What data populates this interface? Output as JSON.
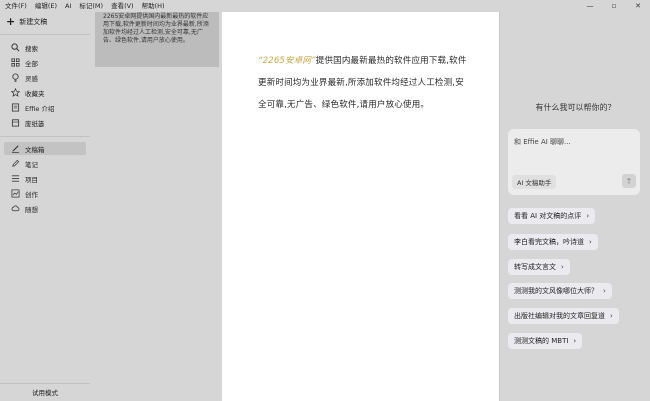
{
  "menubar": {
    "items": [
      "文件(F)",
      "编辑(E)",
      "AI",
      "标记(M)",
      "查看(V)",
      "帮助(H)"
    ],
    "controls": [
      "—",
      "▫",
      "✕"
    ]
  },
  "sidebar": {
    "new_doc": "新建文稿",
    "items": [
      {
        "label": "搜索",
        "icon": "search-icon"
      },
      {
        "label": "全部",
        "icon": "grid-icon"
      },
      {
        "label": "灵感",
        "icon": "lightbulb-icon"
      },
      {
        "label": "收藏夹",
        "icon": "star-icon"
      },
      {
        "label": "Effie 介绍",
        "icon": "document-icon"
      },
      {
        "label": "废纸篓",
        "icon": "trash-icon"
      }
    ],
    "categories": [
      {
        "label": "文稿箱",
        "icon": "pen-icon",
        "active": true
      },
      {
        "label": "笔记",
        "icon": "pencil-icon"
      },
      {
        "label": "项目",
        "icon": "list-icon"
      },
      {
        "label": "创作",
        "icon": "chart-icon"
      },
      {
        "label": "随想",
        "icon": "cloud-icon"
      }
    ],
    "footer": "试用模式"
  },
  "doclist": {
    "card_text": "2265安卓网提供国内最新最热的软件应用下载,软件更新时间均为业界最新,所添加软件均经过人工检测,安全可靠,无广告、绿色软件,请用户放心使用。"
  },
  "editor": {
    "highlight": "“2265安卓网”",
    "body": "提供国内最新最热的软件应用下载,软件更新时间均为业界最新,所添加软件均经过人工检测,安全可靠,无广告、绿色软件,请用户放心使用。"
  },
  "ai": {
    "prompt": "有什么我可以帮你的？",
    "input_placeholder": "和 Effie AI 聊聊...",
    "mode_label": "AI 文稿助手",
    "suggestions": [
      "看看 AI 对文稿的点评",
      "李白看完文稿，吟诗道",
      "转写成文言文",
      "测测我的文风像哪位大师？",
      "出版社编辑对我的文章回复道",
      "测测文稿的 MBTI"
    ]
  }
}
